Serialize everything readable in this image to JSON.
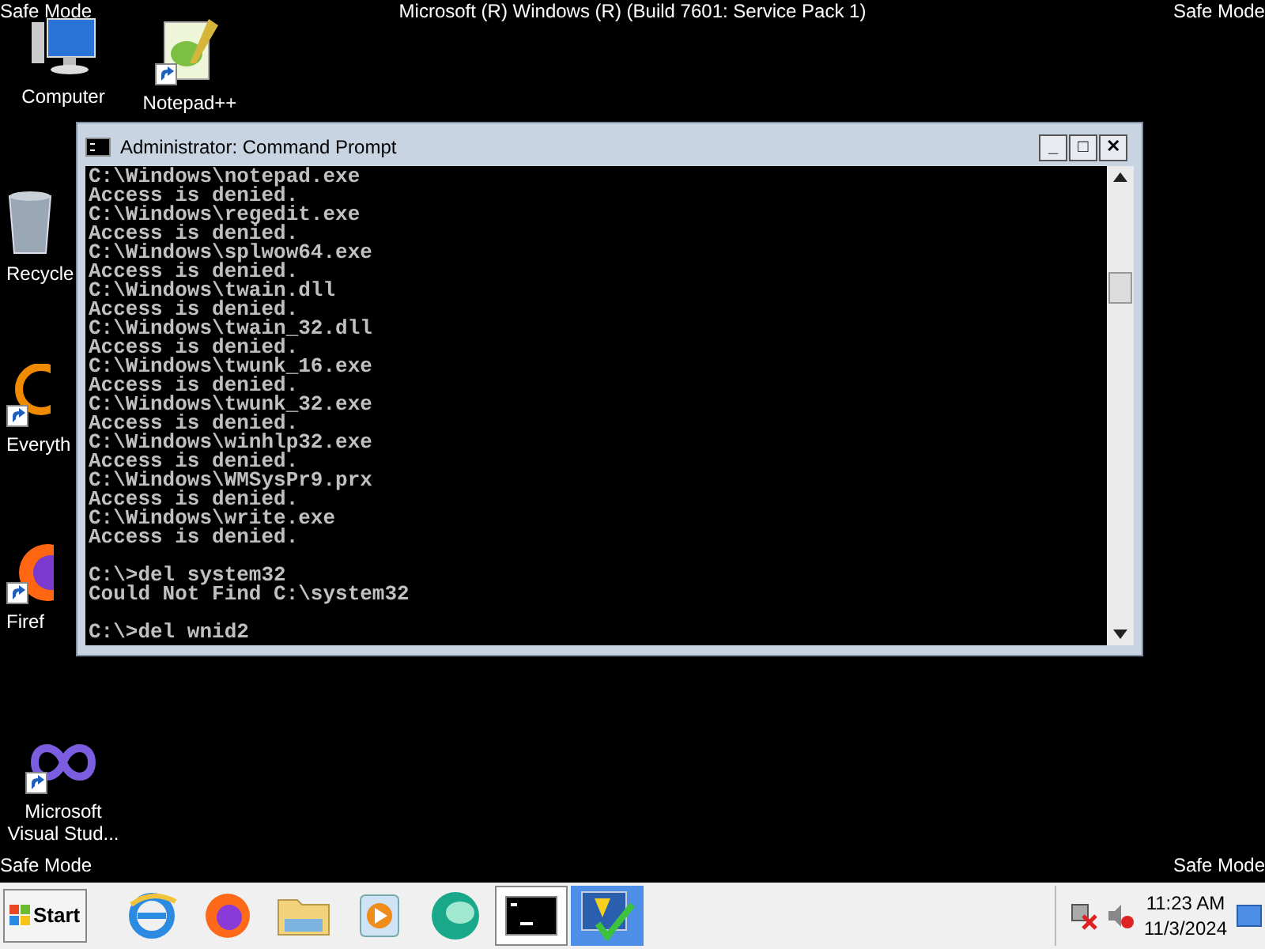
{
  "top_bar": {
    "left": "Safe Mode",
    "center": "Microsoft (R) Windows (R) (Build 7601: Service Pack 1)",
    "right": "Safe Mode"
  },
  "desktop_icons": [
    {
      "kind": "computer",
      "label": "Computer",
      "shortcut": false
    },
    {
      "kind": "notepad",
      "label": "Notepad++",
      "shortcut": true
    },
    {
      "kind": "recycle",
      "label": "Recycle",
      "shortcut": false
    },
    {
      "kind": "everything",
      "label": "Everyth",
      "shortcut": true
    },
    {
      "kind": "firefox",
      "label": "Firef",
      "shortcut": true
    },
    {
      "kind": "visualstudio",
      "label": "Microsoft Visual Stud...",
      "shortcut": true
    }
  ],
  "window": {
    "title": "Administrator: Command Prompt",
    "buttons": [
      "_",
      "□",
      "✕"
    ],
    "console_lines": [
      {
        "text": "C:\\Windows\\notepad.exe",
        "gap_before": false
      },
      {
        "text": "Access is denied.",
        "gap_before": false
      },
      {
        "text": "C:\\Windows\\regedit.exe",
        "gap_before": false
      },
      {
        "text": "Access is denied.",
        "gap_before": false
      },
      {
        "text": "C:\\Windows\\splwow64.exe",
        "gap_before": false
      },
      {
        "text": "Access is denied.",
        "gap_before": false
      },
      {
        "text": "C:\\Windows\\twain.dll",
        "gap_before": false
      },
      {
        "text": "Access is denied.",
        "gap_before": false
      },
      {
        "text": "C:\\Windows\\twain_32.dll",
        "gap_before": false
      },
      {
        "text": "Access is denied.",
        "gap_before": false
      },
      {
        "text": "C:\\Windows\\twunk_16.exe",
        "gap_before": false
      },
      {
        "text": "Access is denied.",
        "gap_before": false
      },
      {
        "text": "C:\\Windows\\twunk_32.exe",
        "gap_before": false
      },
      {
        "text": "Access is denied.",
        "gap_before": false
      },
      {
        "text": "C:\\Windows\\winhlp32.exe",
        "gap_before": false
      },
      {
        "text": "Access is denied.",
        "gap_before": false
      },
      {
        "text": "C:\\Windows\\WMSysPr9.prx",
        "gap_before": false
      },
      {
        "text": "Access is denied.",
        "gap_before": false
      },
      {
        "text": "C:\\Windows\\write.exe",
        "gap_before": false
      },
      {
        "text": "Access is denied.",
        "gap_before": false
      },
      {
        "text": "C:\\>del system32",
        "gap_before": true
      },
      {
        "text": "Could Not Find C:\\system32",
        "gap_before": false
      },
      {
        "text": "C:\\>del wnid2",
        "gap_before": true
      }
    ]
  },
  "bottom_bar": {
    "left": "Safe Mode",
    "right": "Safe Mode"
  },
  "taskbar": {
    "start": "Start",
    "items": [
      {
        "kind": "ie",
        "selected": false
      },
      {
        "kind": "firefox",
        "selected": false
      },
      {
        "kind": "explorer",
        "selected": false
      },
      {
        "kind": "media",
        "selected": false
      },
      {
        "kind": "globe",
        "selected": false
      },
      {
        "kind": "cmd",
        "selected": true
      },
      {
        "kind": "security",
        "selected": false
      }
    ],
    "time": "11:23 AM",
    "date": "11/3/2024"
  }
}
